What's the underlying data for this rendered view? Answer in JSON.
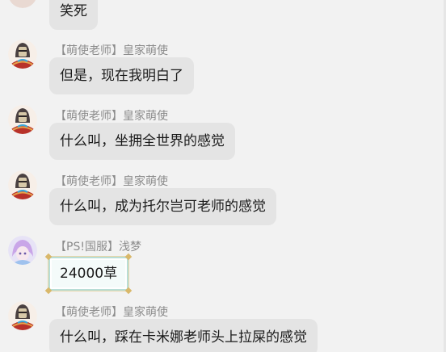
{
  "messages": [
    {
      "sender": "",
      "text": "笑死",
      "avatar": "partial-avatar"
    },
    {
      "sender": "【萌使老师】皇家萌使",
      "text": "但是，现在我明白了",
      "avatar": "knight-avatar"
    },
    {
      "sender": "【萌使老师】皇家萌使",
      "text": "什么叫，坐拥全世界的感觉",
      "avatar": "knight-avatar"
    },
    {
      "sender": "【萌使老师】皇家萌使",
      "text": "什么叫，成为托尔岂可老师的感觉",
      "avatar": "knight-avatar"
    },
    {
      "sender": "【PS!国服】浅梦",
      "text": "24000草",
      "avatar": "anime-girl-avatar"
    },
    {
      "sender": "【萌使老师】皇家萌使",
      "text": "什么叫，踩在卡米娜老师头上拉屎的感觉",
      "avatar": "knight-avatar"
    }
  ],
  "colors": {
    "background": "#f2f2f2",
    "bubble": "#e4e4e4",
    "sender_text": "#8c8c8c",
    "message_text": "#1a1a1a",
    "fancy_bubble_border": "#b7ddd6"
  }
}
